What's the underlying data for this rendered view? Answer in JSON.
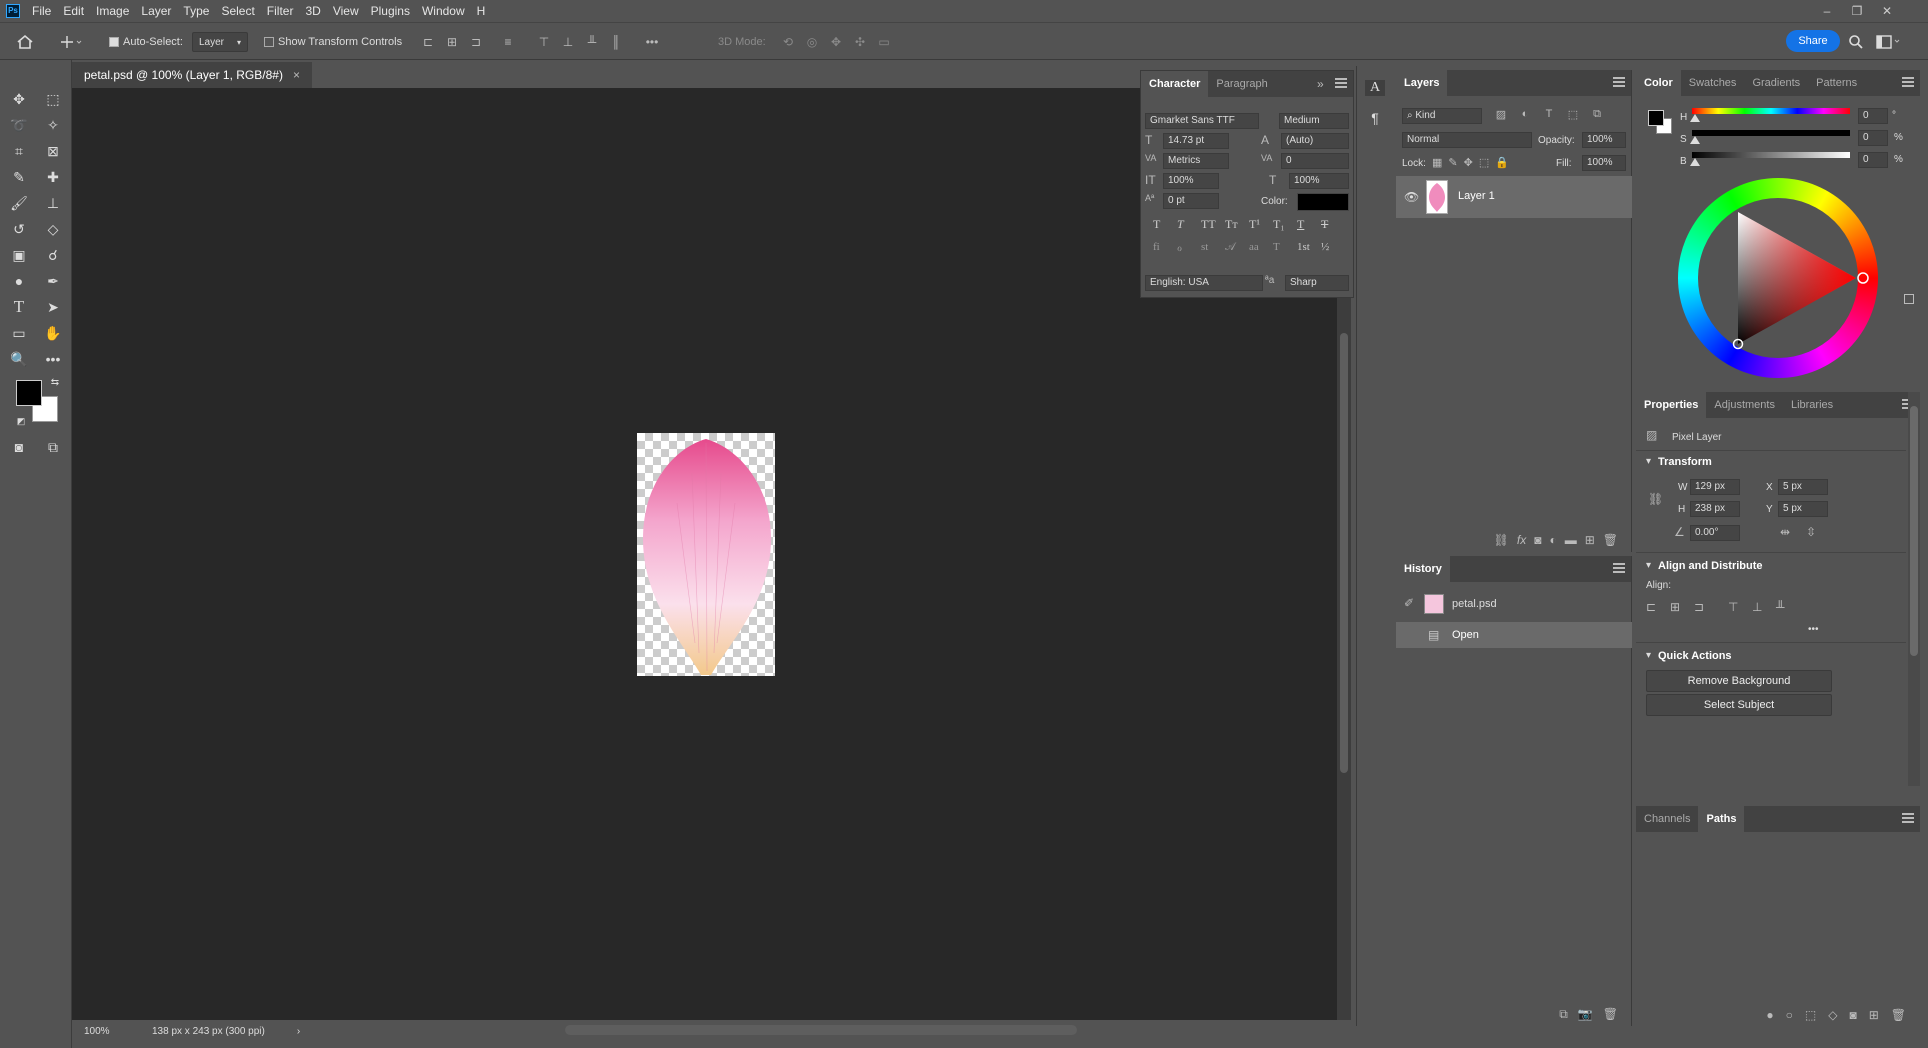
{
  "app": {
    "logo": "Ps"
  },
  "menu": [
    "File",
    "Edit",
    "Image",
    "Layer",
    "Type",
    "Select",
    "Filter",
    "3D",
    "View",
    "Plugins",
    "Window",
    "H"
  ],
  "window": {
    "minimize": "–",
    "restore": "❐",
    "close": "✕"
  },
  "options": {
    "auto_select_label": "Auto-Select:",
    "auto_select_value": "Layer",
    "show_transform_label": "Show Transform Controls",
    "mode_3d_label": "3D Mode:",
    "share_label": "Share"
  },
  "document": {
    "tab_title": "petal.psd @ 100% (Layer 1, RGB/8#)",
    "close": "×"
  },
  "status": {
    "zoom": "100%",
    "info": "138 px x 243 px (300 ppi)"
  },
  "character": {
    "tabs": [
      "Character",
      "Paragraph"
    ],
    "font_family": "Gmarket Sans TTF",
    "font_style": "Medium",
    "font_size": "14.73 pt",
    "leading": "(Auto)",
    "kerning": "Metrics",
    "tracking": "0",
    "vertical_scale": "100%",
    "horizontal_scale": "100%",
    "baseline_shift": "0 pt",
    "color_label": "Color:",
    "language": "English: USA",
    "antialias": "Sharp",
    "text_color": "#000000"
  },
  "layers": {
    "tab": "Layers",
    "filter_kind": "Kind",
    "blend_mode": "Normal",
    "opacity_label": "Opacity:",
    "opacity": "100%",
    "lock_label": "Lock:",
    "fill_label": "Fill:",
    "fill": "100%",
    "items": [
      {
        "name": "Layer 1",
        "visible": true
      }
    ]
  },
  "history": {
    "tab": "History",
    "snapshot": "petal.psd",
    "items": [
      "Open"
    ]
  },
  "color": {
    "tabs": [
      "Color",
      "Swatches",
      "Gradients",
      "Patterns"
    ],
    "h_label": "H",
    "h_value": "0",
    "h_unit": "°",
    "s_label": "S",
    "s_value": "0",
    "s_unit": "%",
    "b_label": "B",
    "b_value": "0",
    "b_unit": "%",
    "foreground": "#000000",
    "background": "#ffffff"
  },
  "properties": {
    "tabs": [
      "Properties",
      "Adjustments",
      "Libraries"
    ],
    "kind": "Pixel Layer",
    "transform_title": "Transform",
    "w_label": "W",
    "w": "129 px",
    "h_label": "H",
    "h": "238 px",
    "x_label": "X",
    "x": "5 px",
    "y_label": "Y",
    "y": "5 px",
    "angle": "0.00°",
    "align_title": "Align and Distribute",
    "align_label": "Align:",
    "quick_actions_title": "Quick Actions",
    "remove_background": "Remove Background",
    "select_subject": "Select Subject"
  },
  "paths": {
    "tabs": [
      "Channels",
      "Paths"
    ]
  }
}
